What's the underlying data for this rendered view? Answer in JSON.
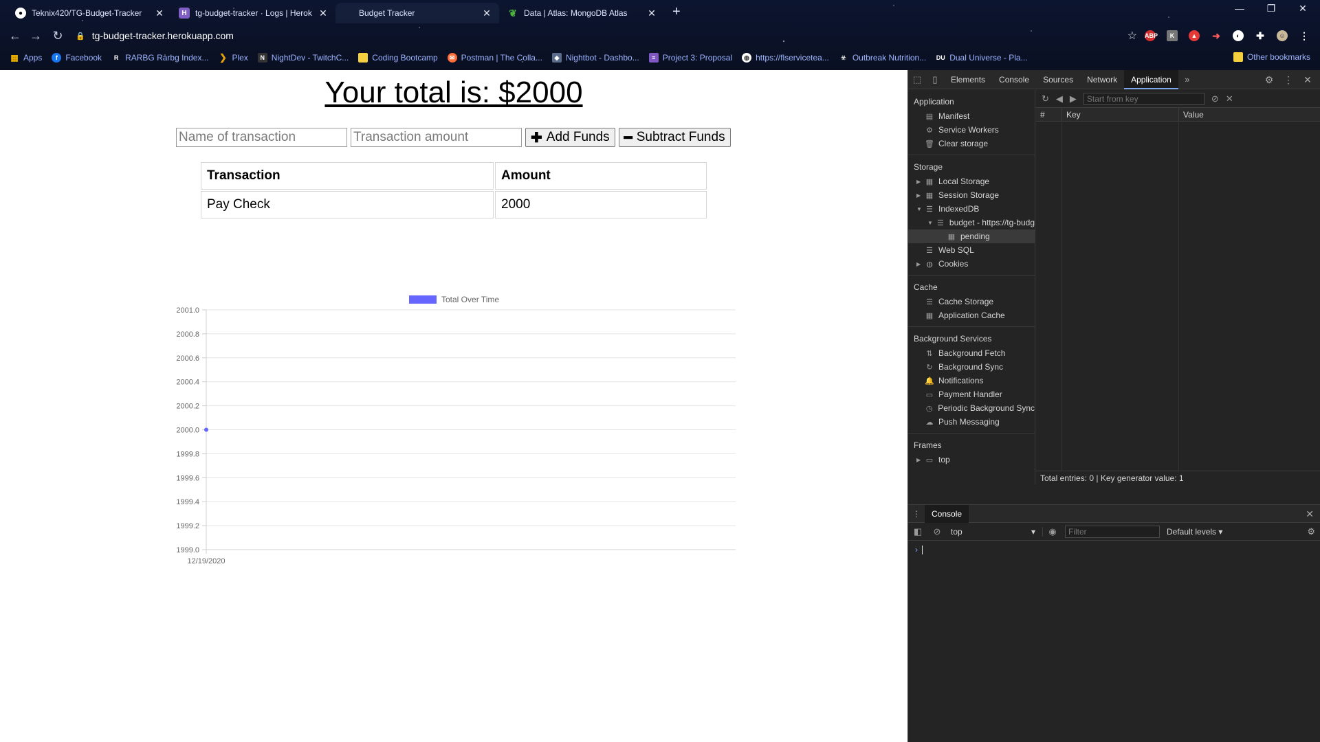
{
  "browser": {
    "tabs": [
      {
        "title": "Teknix420/TG-Budget-Tracker",
        "favicon": "github-icon"
      },
      {
        "title": "tg-budget-tracker · Logs | Herok",
        "favicon": "heroku-icon"
      },
      {
        "title": "Budget Tracker",
        "favicon": "none"
      },
      {
        "title": "Data | Atlas: MongoDB Atlas",
        "favicon": "mongodb-leaf-icon"
      }
    ],
    "url": "tg-budget-tracker.herokuapp.com",
    "bookmarks": [
      {
        "label": "Apps",
        "icon": "apps-grid-icon"
      },
      {
        "label": "Facebook",
        "icon": "facebook-icon"
      },
      {
        "label": "RARBG Rarbg Index...",
        "icon": "rarbg-icon"
      },
      {
        "label": "Plex",
        "icon": "plex-icon"
      },
      {
        "label": "NightDev - TwitchC...",
        "icon": "nightdev-icon"
      },
      {
        "label": "Coding Bootcamp",
        "icon": "folder-icon"
      },
      {
        "label": "Postman | The Colla...",
        "icon": "postman-icon"
      },
      {
        "label": "Nightbot - Dashbo...",
        "icon": "nightbot-icon"
      },
      {
        "label": "Project 3: Proposal",
        "icon": "forms-icon"
      },
      {
        "label": "https://flservicetea...",
        "icon": "globe-icon"
      },
      {
        "label": "Outbreak Nutrition...",
        "icon": "outbreak-icon"
      },
      {
        "label": "Dual Universe - Pla...",
        "icon": "du-icon"
      }
    ],
    "other_bookmarks": "Other bookmarks"
  },
  "app": {
    "total_label": "Your total is: $2000",
    "name_placeholder": "Name of transaction",
    "amount_placeholder": "Transaction amount",
    "add_label": "Add Funds",
    "subtract_label": "Subtract Funds",
    "table": {
      "headers": [
        "Transaction",
        "Amount"
      ],
      "rows": [
        [
          "Pay Check",
          "2000"
        ]
      ]
    }
  },
  "chart_data": {
    "type": "line",
    "x": [
      "12/19/2020"
    ],
    "series": [
      {
        "name": "Total Over Time",
        "values": [
          2000
        ],
        "color": "#6666ff"
      }
    ],
    "ylim": [
      1999.0,
      2001.0
    ],
    "yticks": [
      "2001.0",
      "2000.8",
      "2000.6",
      "2000.4",
      "2000.2",
      "2000.0",
      "1999.8",
      "1999.6",
      "1999.4",
      "1999.2",
      "1999.0"
    ],
    "legend": "top",
    "grid": true
  },
  "devtools": {
    "tabs": [
      "Elements",
      "Console",
      "Sources",
      "Network",
      "Application"
    ],
    "active_tab": "Application",
    "sections": {
      "application": {
        "title": "Application",
        "items": [
          "Manifest",
          "Service Workers",
          "Clear storage"
        ]
      },
      "storage": {
        "title": "Storage",
        "items": [
          "Local Storage",
          "Session Storage",
          "IndexedDB",
          "budget - https://tg-budg",
          "pending",
          "Web SQL",
          "Cookies"
        ]
      },
      "cache": {
        "title": "Cache",
        "items": [
          "Cache Storage",
          "Application Cache"
        ]
      },
      "background": {
        "title": "Background Services",
        "items": [
          "Background Fetch",
          "Background Sync",
          "Notifications",
          "Payment Handler",
          "Periodic Background Sync",
          "Push Messaging"
        ]
      },
      "frames": {
        "title": "Frames",
        "items": [
          "top"
        ]
      }
    },
    "start_from_key_placeholder": "Start from key",
    "grid_headers": [
      "#",
      "Key",
      "Value"
    ],
    "status": "Total entries: 0  |  Key generator value: 1",
    "drawer": {
      "tab": "Console",
      "context": "top",
      "filter_placeholder": "Filter",
      "levels": "Default levels"
    }
  }
}
